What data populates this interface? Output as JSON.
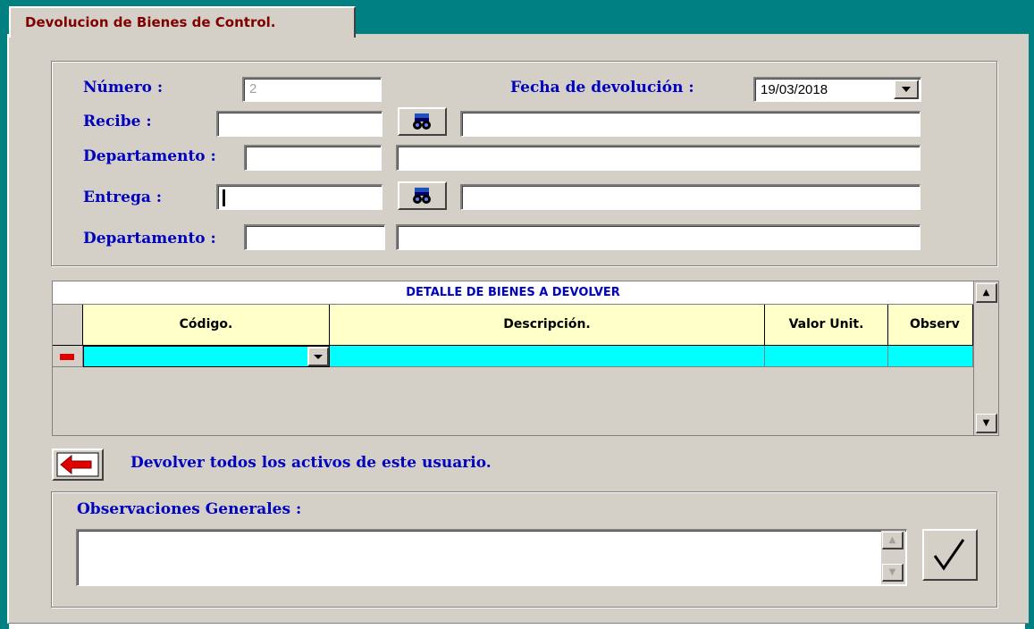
{
  "tab": {
    "title": "Devolucion de Bienes de Control."
  },
  "header": {
    "numero_label": "Número :",
    "numero_value": "2",
    "fecha_label": "Fecha de devolución :",
    "fecha_value": "19/03/2018",
    "recibe_label": "Recibe :",
    "recibe_value": "",
    "recibe_name": "",
    "departamento1_label": "Departamento :",
    "departamento1_code": "",
    "departamento1_name": "",
    "entrega_label": "Entrega :",
    "entrega_value": "",
    "entrega_name": "",
    "departamento2_label": "Departamento :",
    "departamento2_code": "",
    "departamento2_name": ""
  },
  "grid": {
    "caption": "DETALLE DE BIENES A DEVOLVER",
    "columns": [
      "Código.",
      "Descripción.",
      "Valor Unit.",
      "Observ"
    ],
    "rows": [
      {
        "codigo": "",
        "descripcion": "",
        "valor": "",
        "observ": ""
      }
    ]
  },
  "return_all": {
    "label": "Devolver todos los activos de este usuario."
  },
  "observaciones": {
    "label": "Observaciones Generales :",
    "value": ""
  },
  "icons": {
    "search": "binoculars-icon",
    "return": "left-arrow-icon",
    "confirm": "checkmark-icon",
    "dropdown": "chevron-down-icon"
  },
  "colors": {
    "teal": "#008080",
    "label_blue": "#0000c0",
    "tab_text": "#800000",
    "header_yellow": "#ffffc8",
    "row_cyan": "#00ffff"
  }
}
